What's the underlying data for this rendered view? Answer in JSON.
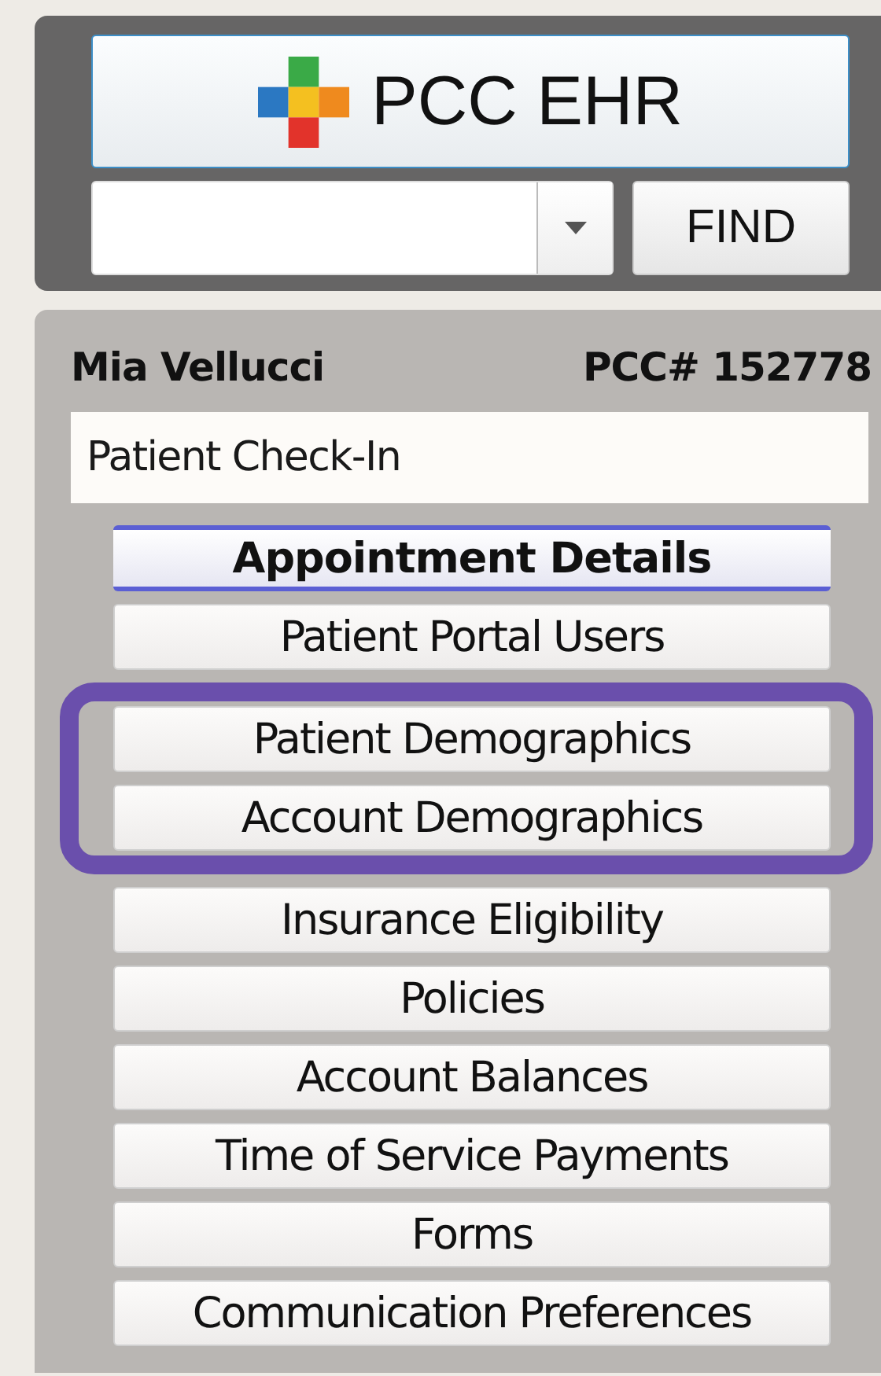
{
  "header": {
    "logo_label": "PCC EHR",
    "find_button": "FIND"
  },
  "patient": {
    "name": "Mia Vellucci",
    "chart_number": "PCC# 152778",
    "workflow": "Patient Check-In"
  },
  "menu": [
    {
      "label": "Appointment Details",
      "selected": true,
      "highlighted": false
    },
    {
      "label": "Patient Portal Users",
      "selected": false,
      "highlighted": false
    },
    {
      "label": "Patient Demographics",
      "selected": false,
      "highlighted": true
    },
    {
      "label": "Account Demographics",
      "selected": false,
      "highlighted": true
    },
    {
      "label": "Insurance Eligibility",
      "selected": false,
      "highlighted": false
    },
    {
      "label": "Policies",
      "selected": false,
      "highlighted": false
    },
    {
      "label": "Account Balances",
      "selected": false,
      "highlighted": false
    },
    {
      "label": "Time of Service Payments",
      "selected": false,
      "highlighted": false
    },
    {
      "label": "Forms",
      "selected": false,
      "highlighted": false
    },
    {
      "label": "Communication Preferences",
      "selected": false,
      "highlighted": false
    }
  ]
}
